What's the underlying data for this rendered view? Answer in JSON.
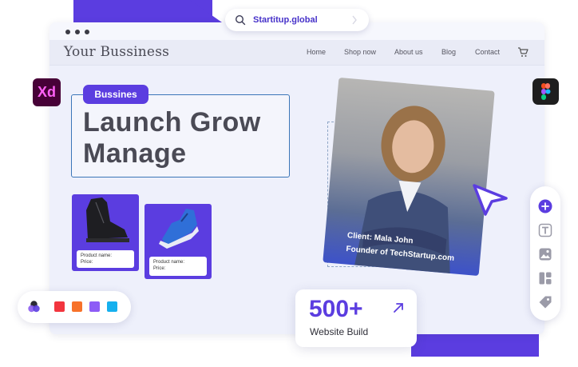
{
  "search": {
    "text": "Startitup.global"
  },
  "site": {
    "brand": "Your Bussiness",
    "nav": [
      "Home",
      "Shop now",
      "About us",
      "Blog",
      "Contact"
    ]
  },
  "hero": {
    "tag": "Bussines",
    "line1": "Launch Grow",
    "line2": "Manage"
  },
  "products": [
    {
      "name_label": "Product name:",
      "price_label": "Price:"
    },
    {
      "name_label": "Product name:",
      "price_label": "Price:"
    }
  ],
  "client": {
    "line1": "Client: Mala John",
    "line2": "Founder of TechStartup.com"
  },
  "stat": {
    "number": "500+",
    "label": "Website Build"
  },
  "badges": {
    "xd": "Xd"
  },
  "palette": [
    "#f2353e",
    "#f7722a",
    "#8d5cf6",
    "#16b0ee"
  ],
  "colors": {
    "accent": "#5b3de0"
  },
  "icons": [
    "search-icon",
    "chevron-right-icon",
    "cart-icon",
    "cursor-arrow-icon",
    "plus-icon",
    "text-icon",
    "image-icon",
    "layout-icon",
    "tag-icon",
    "arrow-up-right-icon",
    "figma-logo-icon",
    "adobe-xd-icon",
    "palette-icon"
  ]
}
